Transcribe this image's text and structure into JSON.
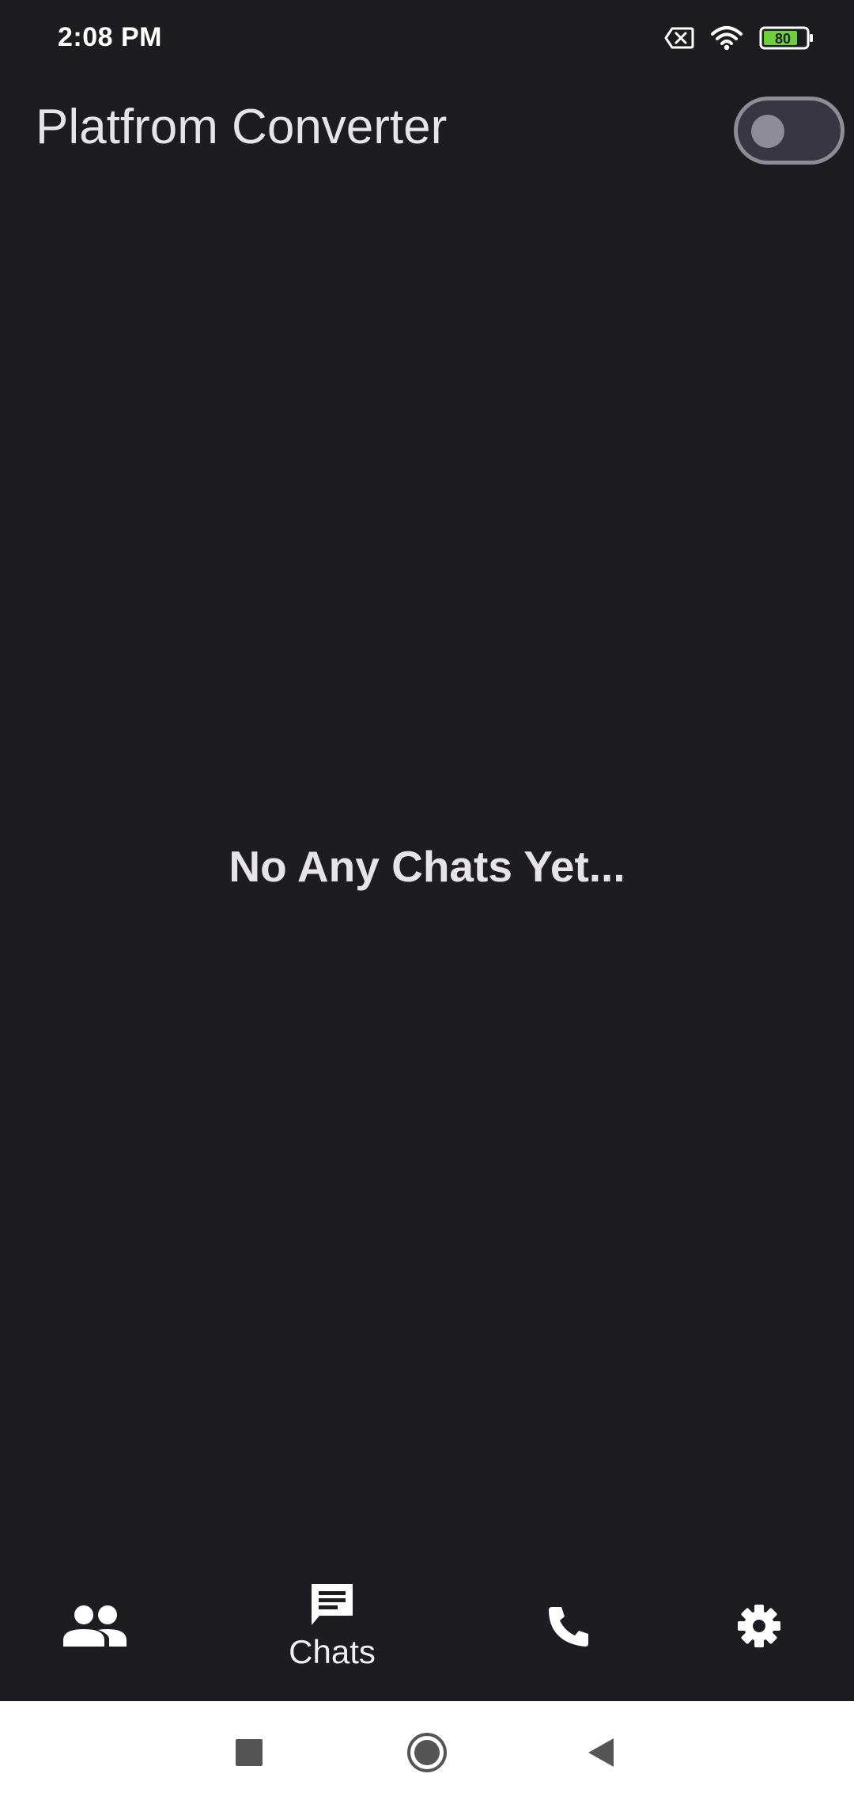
{
  "status_bar": {
    "time": "2:08 PM",
    "battery_level": "80",
    "icons": [
      "sim-off-icon",
      "wifi-icon",
      "battery-icon"
    ]
  },
  "app_bar": {
    "title": "Platfrom Converter",
    "toggle_state": "off"
  },
  "main": {
    "empty_message": "No Any Chats Yet..."
  },
  "bottom_nav": {
    "items": [
      {
        "icon": "people-icon",
        "label": ""
      },
      {
        "icon": "chat-icon",
        "label": "Chats",
        "selected": true
      },
      {
        "icon": "phone-icon",
        "label": ""
      },
      {
        "icon": "settings-gear-icon",
        "label": ""
      }
    ]
  },
  "system_nav": {
    "buttons": [
      "recents-square-icon",
      "home-circle-icon",
      "back-triangle-icon"
    ]
  },
  "colors": {
    "background": "#1d1c21",
    "text": "#e6e4ea",
    "battery_fill": "#6fd13a",
    "system_nav_bg": "#ffffff"
  }
}
